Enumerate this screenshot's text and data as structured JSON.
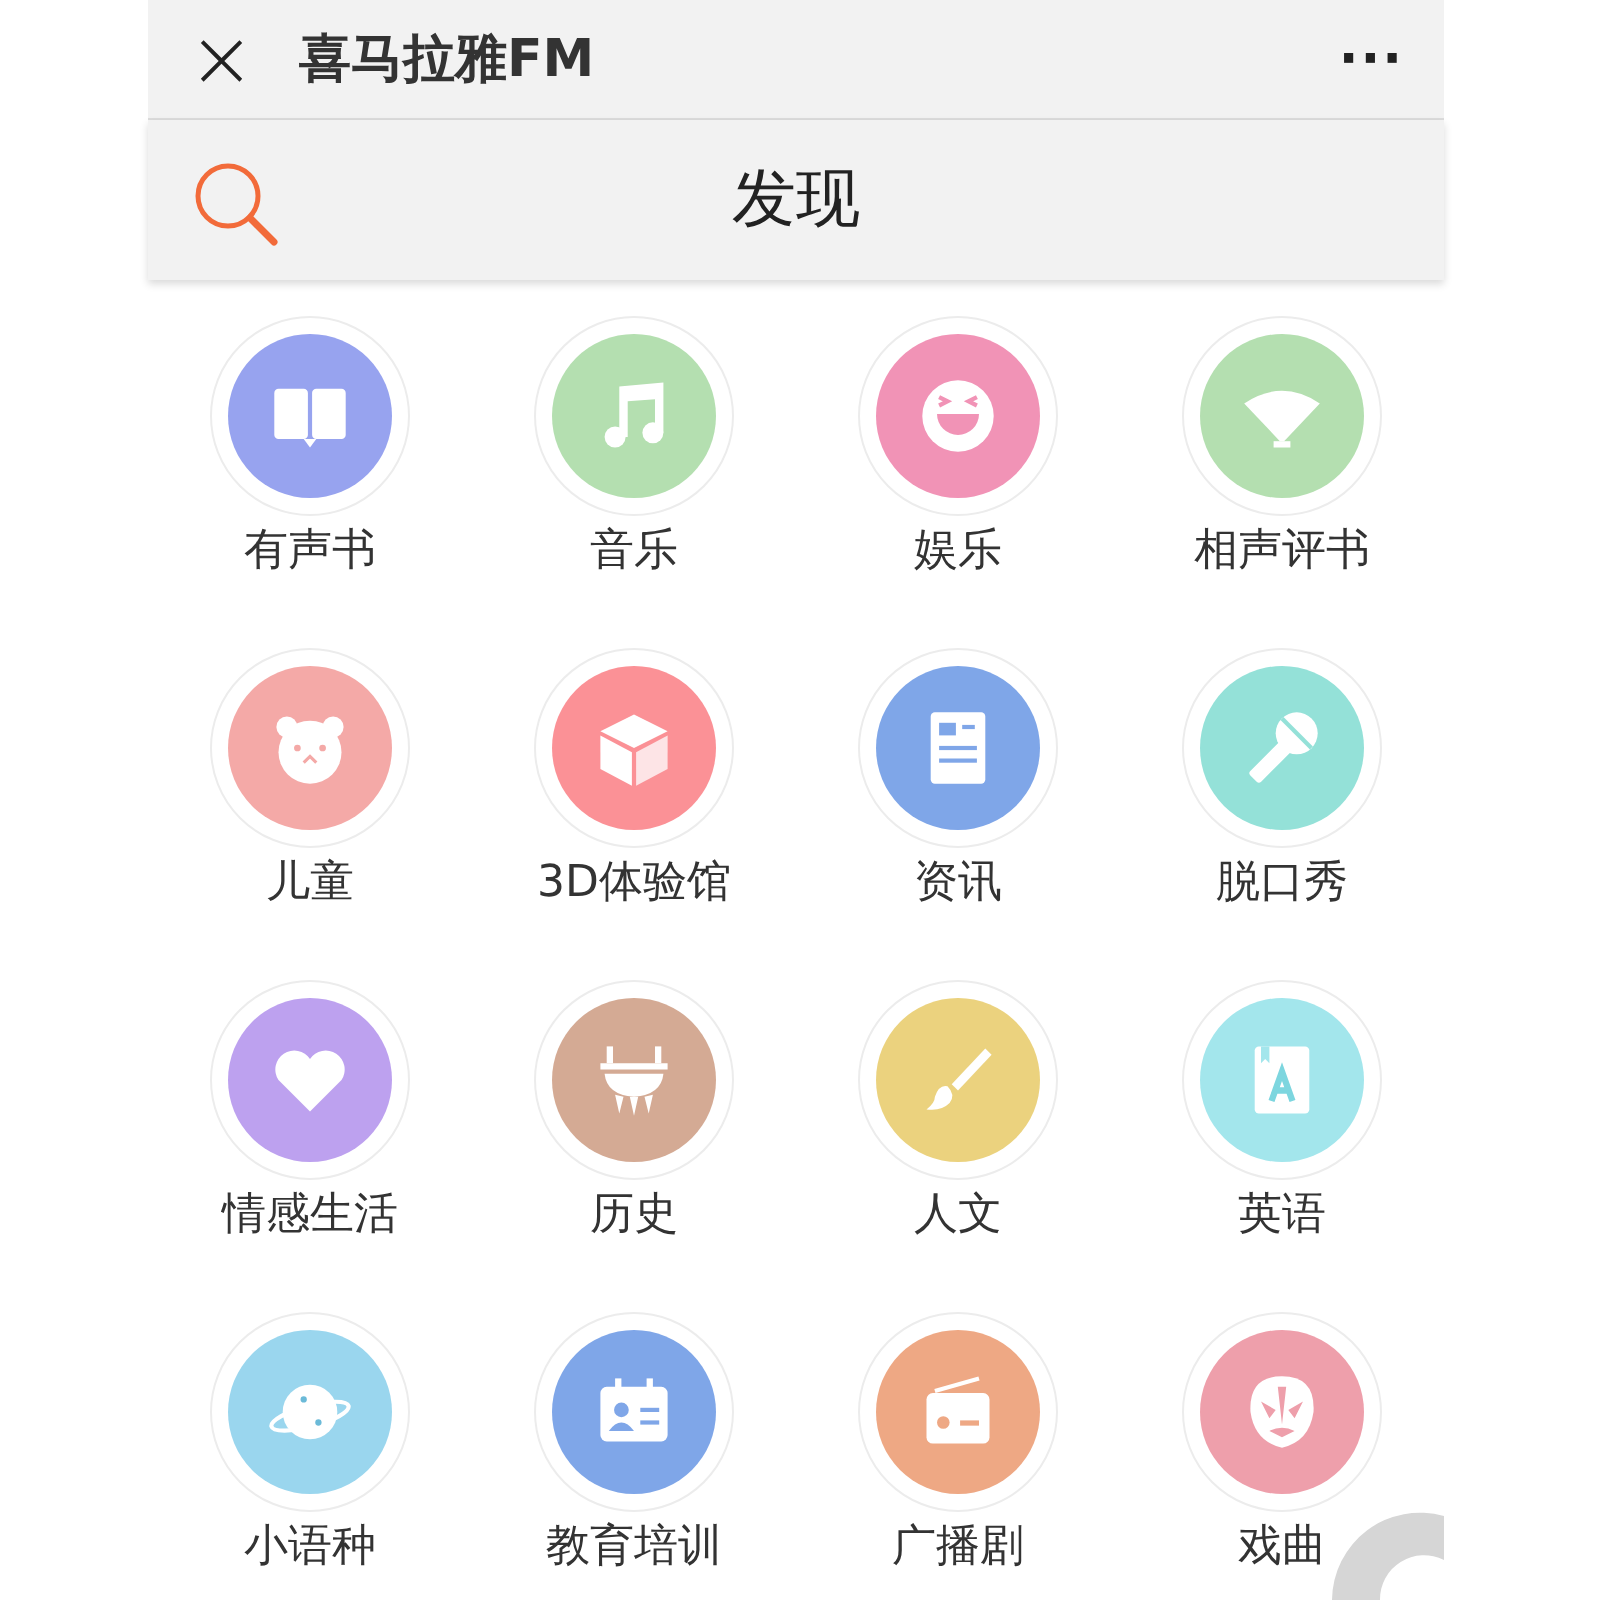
{
  "title_bar": {
    "close": "×",
    "title": "喜马拉雅FM",
    "more": "···"
  },
  "nav_bar": {
    "title": "发现"
  },
  "categories": [
    {
      "label": "有声书",
      "kind": "book",
      "color": "#97a3ef"
    },
    {
      "label": "音乐",
      "kind": "music",
      "color": "#b4dfb0"
    },
    {
      "label": "娱乐",
      "kind": "smile",
      "color": "#f193b6"
    },
    {
      "label": "相声评书",
      "kind": "fan",
      "color": "#b4dfb0"
    },
    {
      "label": "儿童",
      "kind": "bear",
      "color": "#f4a9a7"
    },
    {
      "label": "3D体验馆",
      "kind": "cube",
      "color": "#fb9196"
    },
    {
      "label": "资讯",
      "kind": "news",
      "color": "#7fa6e8"
    },
    {
      "label": "脱口秀",
      "kind": "mic",
      "color": "#94e1d8"
    },
    {
      "label": "情感生活",
      "kind": "heart",
      "color": "#bda1ef"
    },
    {
      "label": "历史",
      "kind": "vessel",
      "color": "#d4aa94"
    },
    {
      "label": "人文",
      "kind": "brush",
      "color": "#ebd27e"
    },
    {
      "label": "英语",
      "kind": "english",
      "color": "#a3e6ec"
    },
    {
      "label": "小语种",
      "kind": "planet",
      "color": "#9ad6ee"
    },
    {
      "label": "教育培训",
      "kind": "card",
      "color": "#7fa6e8"
    },
    {
      "label": "广播剧",
      "kind": "radio",
      "color": "#eea884"
    },
    {
      "label": "戏曲",
      "kind": "mask",
      "color": "#ee9fab"
    }
  ]
}
